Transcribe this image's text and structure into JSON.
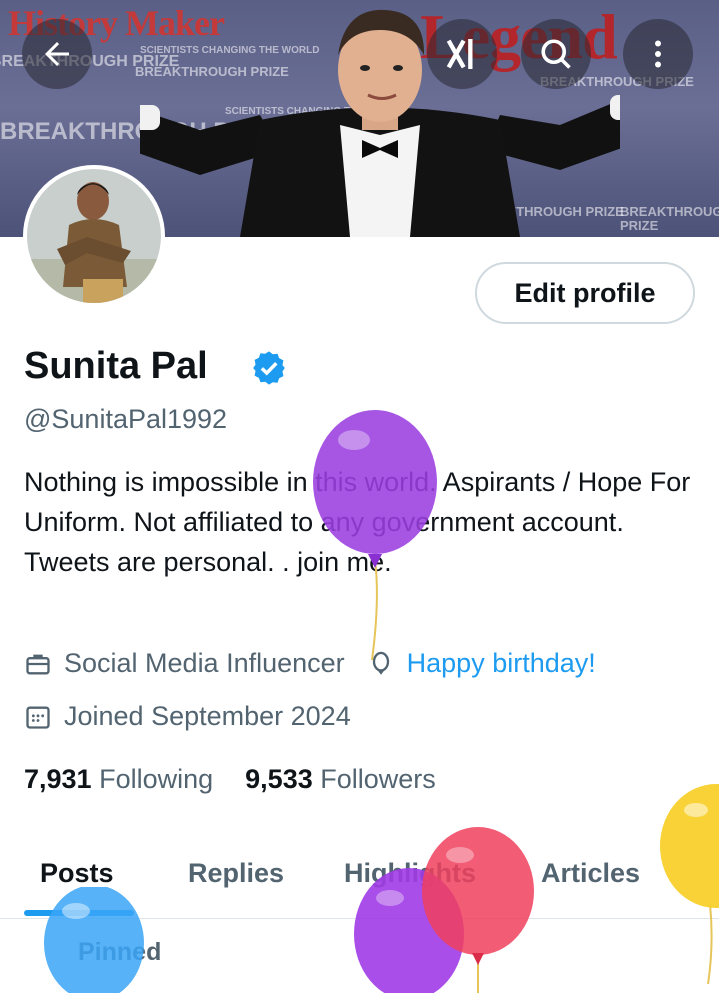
{
  "banner": {
    "logo_left": "History Maker",
    "logo_right": "Legend",
    "bg_text": "BREAKTHROUGH PRIZE",
    "bg_subtext": "SCIENTISTS CHANGING THE WORLD"
  },
  "header": {
    "back_icon": "arrow-left-icon",
    "grok_icon": "grok-icon",
    "search_icon": "search-icon",
    "more_icon": "more-vertical-icon"
  },
  "profile": {
    "edit_label": "Edit profile",
    "name": "Sunita Pal",
    "handle": "@SunitaPal1992",
    "bio": "Nothing is impossible in this world.  Aspirants / Hope For Uniform. Not affiliated to any government account. Tweets are personal. . join me.",
    "profession": "Social Media Influencer",
    "birthday_text": "Happy birthday!",
    "joined": "Joined September 2024",
    "following_count": "7,931",
    "following_label": "Following",
    "followers_count": "9,533",
    "followers_label": "Followers",
    "verified_color": "#1d9bf0"
  },
  "tabs": [
    {
      "label": "Posts"
    },
    {
      "label": "Replies"
    },
    {
      "label": "Highlights"
    },
    {
      "label": "Articles"
    }
  ],
  "pinned_label": "Pinned",
  "colors": {
    "accent": "#1d9bf0",
    "text": "#0f1419",
    "muted": "#536471"
  }
}
